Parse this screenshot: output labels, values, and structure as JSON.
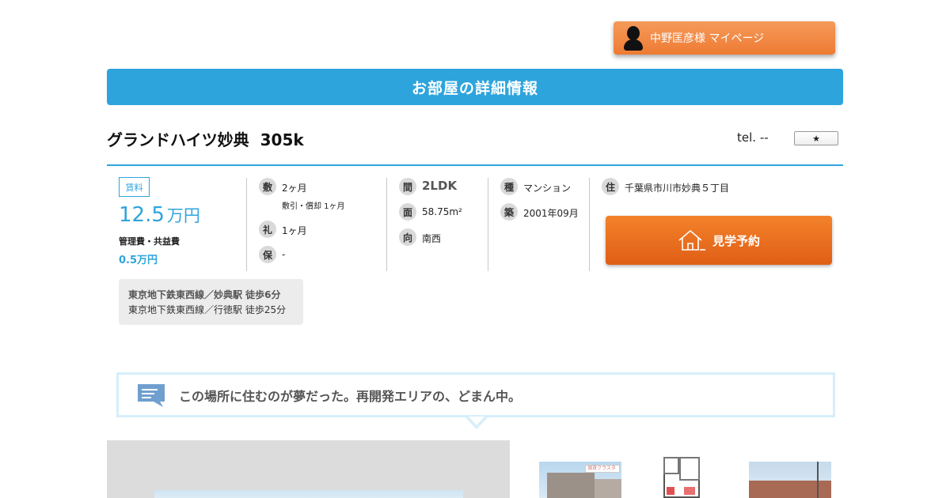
{
  "header": {
    "mypage_label": "中野匡彦様 マイページ",
    "section_title": "お部屋の詳細情報"
  },
  "property": {
    "name": "グランドハイツ妙典",
    "room": "305k",
    "tel": "tel. --",
    "favorite_symbol": "★"
  },
  "rent": {
    "badge": "賃料",
    "amount": "12.5",
    "unit": "万円",
    "mgmt_label": "管理費・共益費",
    "mgmt_value": "0.5万円"
  },
  "details": {
    "shikikin": {
      "icon": "敷",
      "value": "2ヶ月",
      "note": "敷引・償却 1ヶ月"
    },
    "reikin": {
      "icon": "礼",
      "value": "1ヶ月"
    },
    "hoshokin": {
      "icon": "保",
      "value": "-"
    },
    "layout": {
      "icon": "間",
      "value": "2LDK"
    },
    "area": {
      "icon": "面",
      "value": "58.75m²"
    },
    "direction": {
      "icon": "向",
      "value": "南西"
    },
    "type": {
      "icon": "種",
      "value": "マンション"
    },
    "built": {
      "icon": "築",
      "value": "2001年09月"
    },
    "address": {
      "icon": "住",
      "value": "千葉県市川市妙典５丁目"
    }
  },
  "visit_button": {
    "label": "見学予約"
  },
  "stations": [
    "東京地下鉄東西線／妙典駅  徒歩6分",
    "東京地下鉄東西線／行徳駅  徒歩25分"
  ],
  "catch_copy": "この場所に住むのが夢だった。再開発エリアの、どまん中。",
  "thumbnails": {
    "sign_text": "価賃クラスター"
  },
  "colors": {
    "accent_blue": "#2ea4dd",
    "orange": "#ee7b32",
    "visit_orange": "#e8681d"
  }
}
